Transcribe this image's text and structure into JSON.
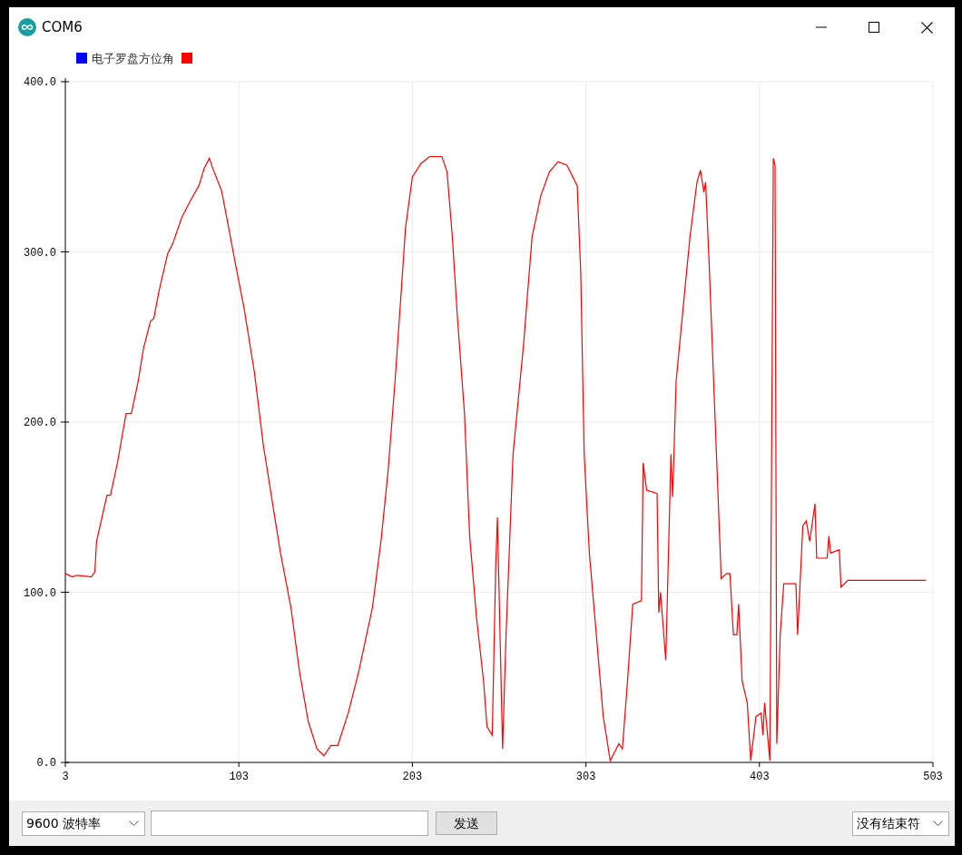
{
  "window": {
    "title": "COM6"
  },
  "plotter": {
    "legend": [
      {
        "label": "电子罗盘方位角",
        "color": "#0000ff"
      },
      {
        "color": "#ff0000"
      }
    ],
    "chart_data": {
      "type": "line",
      "grid": true,
      "xlim": [
        3,
        503
      ],
      "ylim": [
        0,
        400
      ],
      "xticks": [
        3,
        103,
        203,
        303,
        403,
        503
      ],
      "yticks": [
        {
          "value": 0,
          "label": "0.0"
        },
        {
          "value": 100,
          "label": "100.0"
        },
        {
          "value": 200,
          "label": "200.0"
        },
        {
          "value": 300,
          "label": "300.0"
        },
        {
          "value": 400,
          "label": "400.0"
        }
      ],
      "x": [
        3,
        7,
        10,
        18,
        20,
        21,
        27,
        29,
        33,
        38,
        41,
        45,
        48,
        52,
        54,
        57,
        62,
        65,
        70,
        75,
        80,
        83,
        86,
        88,
        93,
        97,
        101,
        106,
        112,
        117,
        122,
        127,
        133,
        138,
        143,
        148,
        152,
        156,
        160,
        166,
        172,
        180,
        185,
        189,
        193,
        197,
        199,
        203,
        208,
        213,
        220,
        223,
        226,
        229,
        233,
        236,
        240,
        244,
        246,
        249,
        251,
        252,
        255,
        257,
        261,
        267,
        272,
        277,
        282,
        287,
        292,
        298,
        300,
        302,
        305,
        309,
        313,
        317,
        322,
        324,
        327,
        330,
        335,
        336,
        338,
        344,
        345,
        346,
        349,
        352,
        353,
        355,
        359,
        363,
        367,
        369,
        371,
        372,
        374,
        381,
        384,
        386,
        388,
        390,
        391,
        393,
        396,
        398,
        401,
        404,
        405,
        406,
        409,
        411,
        412,
        413,
        415,
        417,
        424,
        425,
        428,
        430,
        432,
        435,
        436,
        442,
        443,
        444,
        449,
        450,
        454,
        499
      ],
      "series": [
        {
          "color": "#ff0000",
          "values": [
            111,
            109,
            110,
            109,
            112,
            130,
            157,
            157,
            176,
            205,
            205,
            224,
            243,
            259,
            261,
            277,
            299,
            305,
            320,
            330,
            339,
            349,
            355,
            349,
            336,
            315,
            293,
            267,
            229,
            187,
            155,
            123,
            91,
            53,
            24,
            8,
            4,
            10,
            10,
            29,
            53,
            91,
            131,
            171,
            224,
            283,
            314,
            344,
            352,
            356,
            356,
            347,
            309,
            261,
            205,
            133,
            85,
            48,
            21,
            16,
            115,
            144,
            8,
            75,
            181,
            245,
            309,
            333,
            347,
            353,
            351,
            339,
            288,
            181,
            123,
            75,
            27,
            1,
            11,
            8,
            48,
            93,
            95,
            176,
            160,
            158,
            88,
            100,
            60,
            181,
            156,
            224,
            267,
            309,
            341,
            348,
            335,
            341,
            293,
            108,
            111,
            111,
            75,
            75,
            93,
            48,
            35,
            1,
            27,
            29,
            16,
            35,
            1,
            355,
            351,
            11,
            75,
            105,
            105,
            75,
            139,
            142,
            130,
            152,
            120,
            120,
            133,
            123,
            125,
            103,
            107,
            107
          ]
        }
      ]
    }
  },
  "controls": {
    "baud_rate": "9600 波特率",
    "send_button": "发送",
    "line_ending": "没有结束符"
  }
}
